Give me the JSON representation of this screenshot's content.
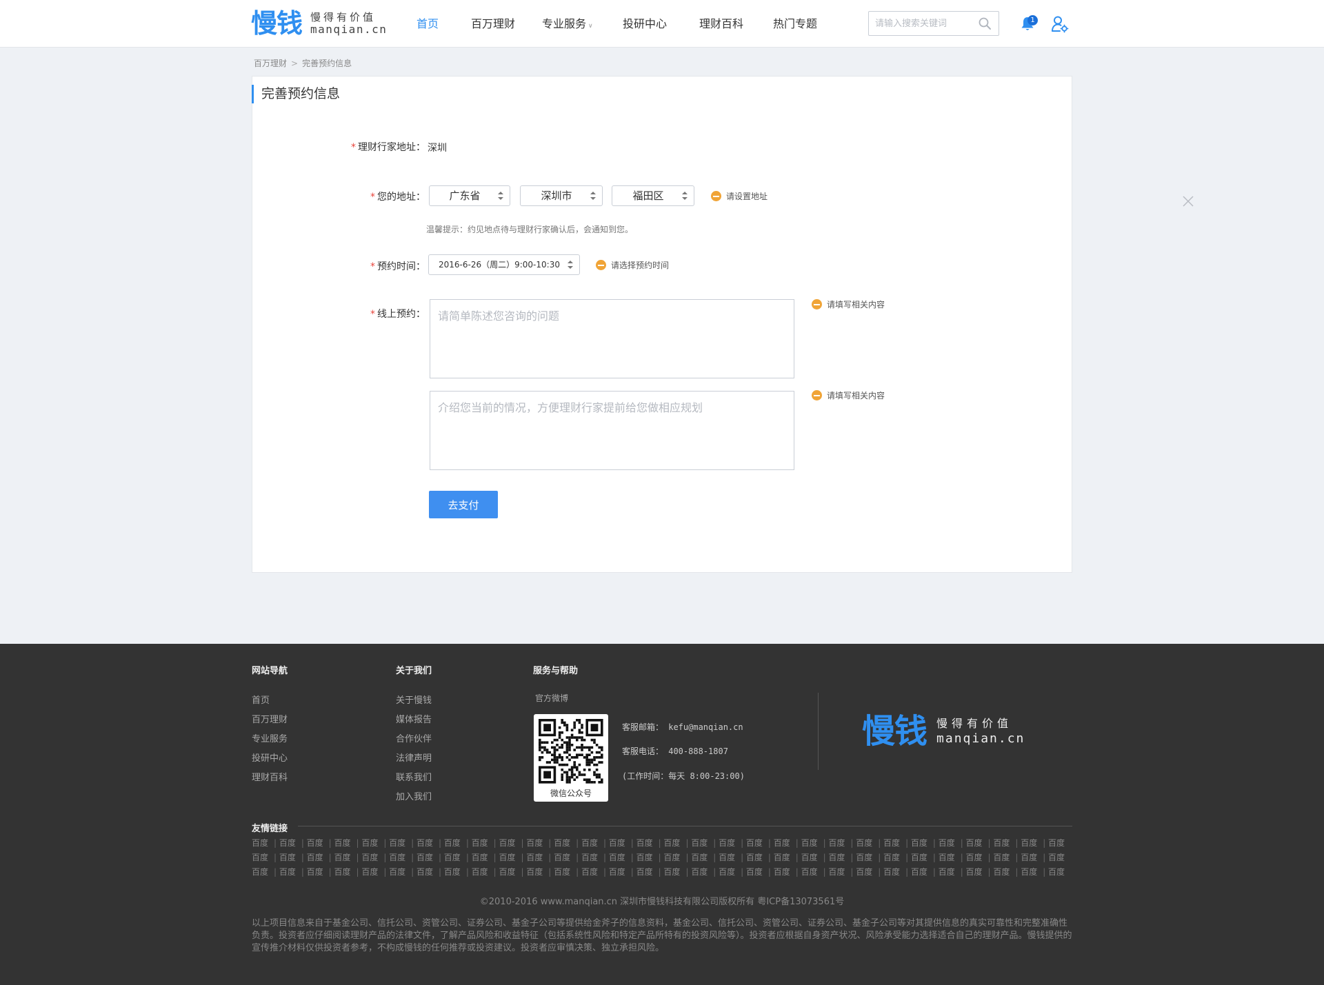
{
  "header": {
    "logo_mark": "慢钱",
    "logo_slogan": "慢得有价值",
    "logo_domain": "manqian.cn",
    "nav": [
      {
        "label": "首页",
        "active": true
      },
      {
        "label": "百万理财"
      },
      {
        "label": "专业服务",
        "has_dropdown": true
      },
      {
        "label": "投研中心"
      },
      {
        "label": "理财百科"
      },
      {
        "label": "热门专题"
      }
    ],
    "search_placeholder": "请输入搜索关键词",
    "notification_count": "1",
    "accent_color": "#2f8ff0"
  },
  "breadcrumb": {
    "parent": "百万理财",
    "separator": ">",
    "current": "完善预约信息"
  },
  "form": {
    "title": "完善预约信息",
    "required_mark": "*",
    "advisor_address_label": "理财行家地址：",
    "advisor_address_value": "深圳",
    "your_address_label": "您的地址：",
    "province": "广东省",
    "city": "深圳市",
    "district": "福田区",
    "address_hint": "请设置地址",
    "address_tip": "温馨提示：约见地点待与理财行家确认后，会通知到您。",
    "time_label": "预约时间：",
    "time_value": "2016-6-26（周二）9:00-10:30",
    "time_hint": "请选择预约时间",
    "online_label": "线上预约：",
    "question_placeholder": "请简单陈述您咨询的问题",
    "question_hint": "请填写相关内容",
    "situation_placeholder": "介绍您当前的情况，方便理财行家提前给您做相应规划",
    "situation_hint": "请填写相关内容",
    "pay_button": "去支付"
  },
  "footer": {
    "nav_title": "网站导航",
    "nav_links": [
      "首页",
      "百万理财",
      "专业服务",
      "投研中心",
      "理财百科"
    ],
    "about_title": "关于我们",
    "about_links": [
      "关于慢钱",
      "媒体报告",
      "合作伙伴",
      "法律声明",
      "联系我们",
      "加入我们"
    ],
    "help_title": "服务与帮助",
    "weibo_label": "官方微博",
    "qr_caption": "微信公众号",
    "email": "客服邮箱： kefu@manqian.cn",
    "phone": "客服电话： 400-888-1807",
    "hours": "(工作时间：每天 8:00-23:00)",
    "friend_links_title": "友情链接",
    "friend_link_label": "百度",
    "copyright": "©2010-2016 www.manqian.cn 深圳市慢钱科技有限公司版权所有   粤ICP备13073561号",
    "disclaimer": "以上项目信息来自于基金公司、信托公司、资管公司、证券公司、基金子公司等提供给金斧子的信息资料，基金公司、信托公司、资管公司、证券公司、基金子公司等对其提供信息的真实可靠性和完整准确性负责。投资者应仔细阅读理财产品的法律文件，了解产品风险和收益特征（包括系统性风险和特定产品所特有的投资风险等）。投资者应根据自身资产状况、风险承受能力选择适合自己的理财产品。慢钱提供的宣传推介材料仅供投资者参考，不构成慢钱的任何推荐或投资建议。投资者应审慎决策、独立承担风险。"
  }
}
